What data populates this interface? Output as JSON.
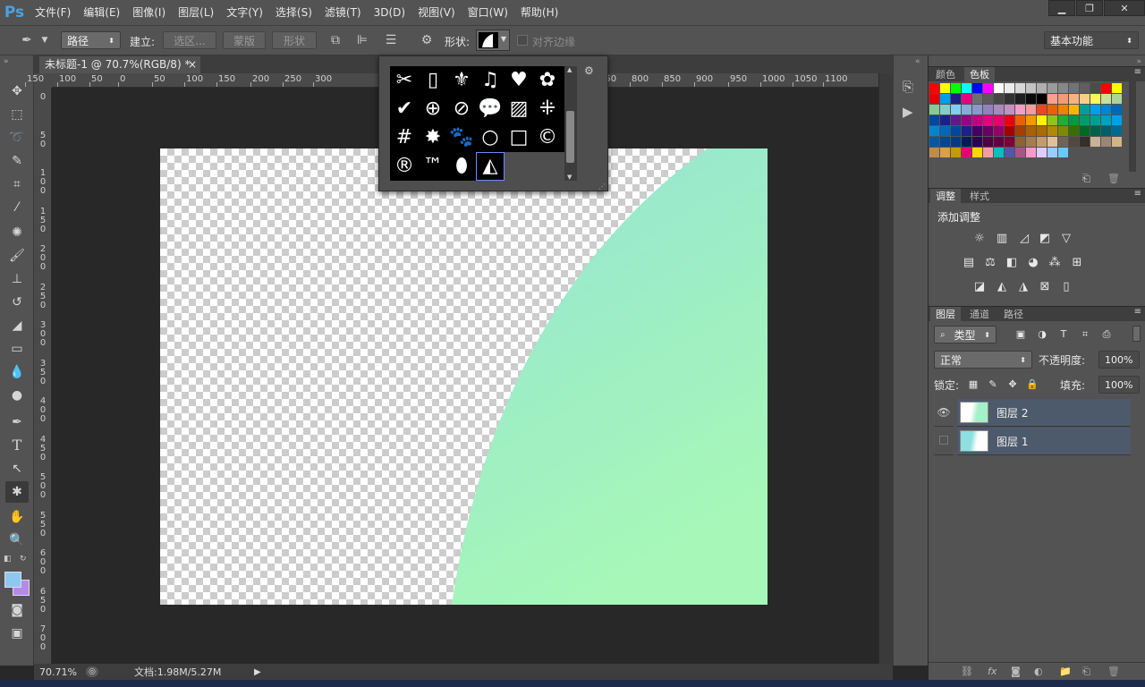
{
  "app": {
    "logo": "Ps"
  },
  "menu": [
    "文件(F)",
    "编辑(E)",
    "图像(I)",
    "图层(L)",
    "文字(Y)",
    "选择(S)",
    "滤镜(T)",
    "3D(D)",
    "视图(V)",
    "窗口(W)",
    "帮助(H)"
  ],
  "window_controls": {
    "minimize": "▁",
    "restore": "❐",
    "close": "✕"
  },
  "options": {
    "mode_value": "路径",
    "make_label": "建立:",
    "selection_btn": "选区...",
    "mask_btn": "蒙版",
    "shape_btn": "形状",
    "shape_label": "形状:",
    "align_edges_label": "对齐边缘",
    "workspace_value": "基本功能"
  },
  "document": {
    "tab_title": "未标题-1 @ 70.7%(RGB/8) *",
    "close": "×",
    "zoom": "70.71%",
    "doc_info": "文档:1.98M/5.27M",
    "shape_color_top": "#95e3d4",
    "shape_color_bottom": "#a6f7b8"
  },
  "ruler_h": [
    "150",
    "100",
    "50",
    "0",
    "50",
    "100",
    "150",
    "200",
    "250",
    "300",
    "700",
    "750",
    "800",
    "850",
    "900",
    "950",
    "1000",
    "1050",
    "1100"
  ],
  "ruler_v": [
    "0",
    "50",
    "100",
    "150",
    "200",
    "250",
    "300",
    "350",
    "400",
    "450",
    "500",
    "550",
    "600",
    "650",
    "700"
  ],
  "shape_picker": {
    "shapes": [
      "scissors-shape",
      "frame-shape",
      "fleur-de-lis-shape",
      "music-note-shape",
      "heart-shape",
      "blob-shape",
      "checkmark-shape",
      "target-shape",
      "no-sign-shape",
      "speech-bubble-shape",
      "diagonal-hatch-shape",
      "grid-diamond-shape",
      "grid-shape",
      "starburst-shape",
      "paw-shape",
      "circle-frame-shape",
      "square-frame-shape",
      "copyright-shape",
      "registered-shape",
      "trademark-shape",
      "leaf-shape",
      "custom-arc-shape"
    ],
    "glyphs": [
      "✂",
      "▯",
      "⚜",
      "♫",
      "♥",
      "✿",
      "✔",
      "⊕",
      "⊘",
      "💬",
      "▨",
      "⁜",
      "#",
      "✸",
      "🐾",
      "○",
      "□",
      "©",
      "®",
      "™",
      "⬮",
      "◭"
    ],
    "selected_index": 21
  },
  "right_panel": {
    "tabs_top": [
      "颜色",
      "色板"
    ],
    "tabs_adjust": [
      "调整",
      "样式"
    ],
    "adjust_title": "添加调整",
    "tabs_layers": [
      "图层",
      "通道",
      "路径"
    ],
    "filter_value": "类型",
    "blend_mode": "正常",
    "opacity_label": "不透明度:",
    "opacity_value": "100%",
    "lock_label": "锁定:",
    "fill_label": "填充:",
    "fill_value": "100%",
    "layers": [
      {
        "name": "图层 2",
        "visible": true
      },
      {
        "name": "图层 1",
        "visible": false
      }
    ]
  },
  "swatch_colors": [
    "#ff0000",
    "#ffff00",
    "#00ff00",
    "#00ffff",
    "#0000ff",
    "#ff00ff",
    "#ffffff",
    "#ebebeb",
    "#d7d7d7",
    "#c3c3c3",
    "#afafaf",
    "#9b9b9b",
    "#878787",
    "#737373",
    "#5f5f5f",
    "#4b4b4b",
    "#ff0000",
    "#ffff00",
    "#e60000",
    "#00a0e9",
    "#1d2088",
    "#e4007f",
    "#6f6f6f",
    "#5a5a5a",
    "#464646",
    "#323232",
    "#1e1e1e",
    "#0a0a0a",
    "#000000",
    "#f9a18a",
    "#f29b76",
    "#f6b37f",
    "#facd89",
    "#fff45c",
    "#cce198",
    "#acd598",
    "#89c997",
    "#84ccc9",
    "#7ecef4",
    "#88abda",
    "#8c97cb",
    "#8f82bc",
    "#aa89bd",
    "#c490bf",
    "#f19ec2",
    "#f29c9f",
    "#e94820",
    "#ea6100",
    "#ef8200",
    "#f8b500",
    "#009e96",
    "#00a0e9",
    "#0086d1",
    "#0068b7",
    "#00479d",
    "#1d2088",
    "#601986",
    "#920783",
    "#be0081",
    "#e4007f",
    "#e5006a",
    "#e60012",
    "#eb6100",
    "#f39800",
    "#fff100",
    "#8fc31f",
    "#22ac38",
    "#009944",
    "#009b6b",
    "#009e96",
    "#00a0c1",
    "#00a0e9",
    "#0086d1",
    "#0068b7",
    "#00479d",
    "#1d2088",
    "#440062",
    "#6a005f",
    "#94006b",
    "#a40000",
    "#a53e00",
    "#a86200",
    "#ac6a00",
    "#b08a00",
    "#7c8b00",
    "#376f00",
    "#006a24",
    "#00624a",
    "#005f68",
    "#006b92",
    "#0059a0",
    "#00478e",
    "#003b83",
    "#001c58",
    "#2a004f",
    "#4d0045",
    "#640041",
    "#7c0038",
    "#8c6239",
    "#a67c52",
    "#c69c6d",
    "#e0c09b",
    "#736357",
    "#534741",
    "#362e2b",
    "#c7b299",
    "#998675",
    "#d2b48c",
    "#bf8b4b",
    "#d9a04a",
    "#c59a00",
    "#e60073",
    "#ffd400",
    "#f29c9f",
    "#00c0c0",
    "#5555aa",
    "#aa5588",
    "#ff99cc",
    "#ddccff",
    "#99ccff",
    "#66ccff"
  ],
  "status_bar": {
    "arrow": "▶"
  }
}
